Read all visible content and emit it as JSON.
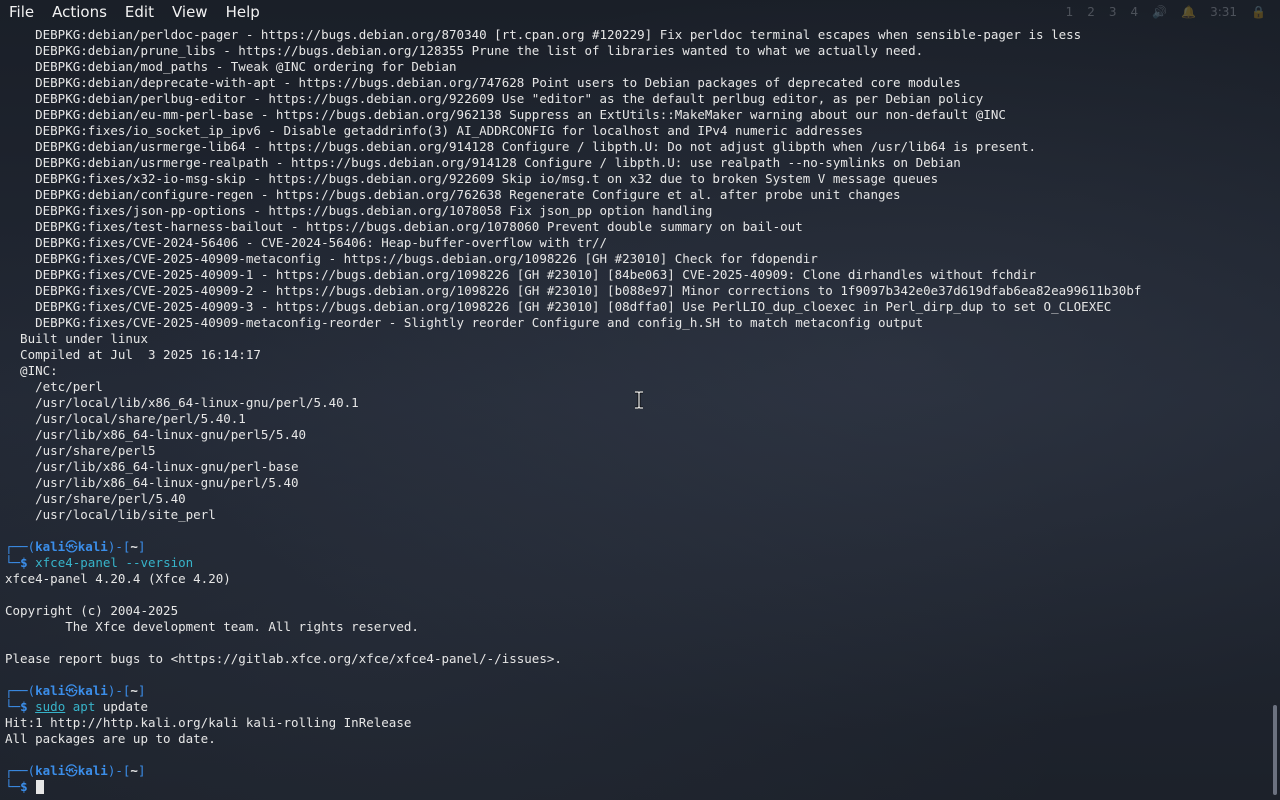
{
  "menubar": {
    "items": [
      "File",
      "Actions",
      "Edit",
      "View",
      "Help"
    ]
  },
  "tray": {
    "workspaces": [
      "1",
      "2",
      "3",
      "4"
    ],
    "clock": "3:31"
  },
  "terminal": {
    "output_top": [
      "    DEBPKG:debian/perldoc-pager - https://bugs.debian.org/870340 [rt.cpan.org #120229] Fix perldoc terminal escapes when sensible-pager is less",
      "    DEBPKG:debian/prune_libs - https://bugs.debian.org/128355 Prune the list of libraries wanted to what we actually need.",
      "    DEBPKG:debian/mod_paths - Tweak @INC ordering for Debian",
      "    DEBPKG:debian/deprecate-with-apt - https://bugs.debian.org/747628 Point users to Debian packages of deprecated core modules",
      "    DEBPKG:debian/perlbug-editor - https://bugs.debian.org/922609 Use \"editor\" as the default perlbug editor, as per Debian policy",
      "    DEBPKG:debian/eu-mm-perl-base - https://bugs.debian.org/962138 Suppress an ExtUtils::MakeMaker warning about our non-default @INC",
      "    DEBPKG:fixes/io_socket_ip_ipv6 - Disable getaddrinfo(3) AI_ADDRCONFIG for localhost and IPv4 numeric addresses",
      "    DEBPKG:debian/usrmerge-lib64 - https://bugs.debian.org/914128 Configure / libpth.U: Do not adjust glibpth when /usr/lib64 is present.",
      "    DEBPKG:debian/usrmerge-realpath - https://bugs.debian.org/914128 Configure / libpth.U: use realpath --no-symlinks on Debian",
      "    DEBPKG:fixes/x32-io-msg-skip - https://bugs.debian.org/922609 Skip io/msg.t on x32 due to broken System V message queues",
      "    DEBPKG:debian/configure-regen - https://bugs.debian.org/762638 Regenerate Configure et al. after probe unit changes",
      "    DEBPKG:fixes/json-pp-options - https://bugs.debian.org/1078058 Fix json_pp option handling",
      "    DEBPKG:fixes/test-harness-bailout - https://bugs.debian.org/1078060 Prevent double summary on bail-out",
      "    DEBPKG:fixes/CVE-2024-56406 - CVE-2024-56406: Heap-buffer-overflow with tr//",
      "    DEBPKG:fixes/CVE-2025-40909-metaconfig - https://bugs.debian.org/1098226 [GH #23010] Check for fdopendir",
      "    DEBPKG:fixes/CVE-2025-40909-1 - https://bugs.debian.org/1098226 [GH #23010] [84be063] CVE-2025-40909: Clone dirhandles without fchdir",
      "    DEBPKG:fixes/CVE-2025-40909-2 - https://bugs.debian.org/1098226 [GH #23010] [b088e97] Minor corrections to 1f9097b342e0e37d619dfab6ea82ea99611b30bf",
      "    DEBPKG:fixes/CVE-2025-40909-3 - https://bugs.debian.org/1098226 [GH #23010] [08dffa0] Use PerlLIO_dup_cloexec in Perl_dirp_dup to set O_CLOEXEC",
      "    DEBPKG:fixes/CVE-2025-40909-metaconfig-reorder - Slightly reorder Configure and config_h.SH to match metaconfig output",
      "  Built under linux",
      "  Compiled at Jul  3 2025 16:14:17",
      "  @INC:",
      "    /etc/perl",
      "    /usr/local/lib/x86_64-linux-gnu/perl/5.40.1",
      "    /usr/local/share/perl/5.40.1",
      "    /usr/lib/x86_64-linux-gnu/perl5/5.40",
      "    /usr/share/perl5",
      "    /usr/lib/x86_64-linux-gnu/perl-base",
      "    /usr/lib/x86_64-linux-gnu/perl/5.40",
      "    /usr/share/perl/5.40",
      "    /usr/local/lib/site_perl",
      ""
    ],
    "prompt": {
      "top_left": "┌──(",
      "user": "kali",
      "at": "㉿",
      "host": "kali",
      "mid": ")-[",
      "dir": "~",
      "end": "]",
      "bottom_left": "└─",
      "dollar": "$"
    },
    "cmd1": {
      "command": "xfce4-panel",
      "args": "--version"
    },
    "output_cmd1": [
      "xfce4-panel 4.20.4 (Xfce 4.20)",
      "",
      "Copyright (c) 2004-2025",
      "        The Xfce development team. All rights reserved.",
      "",
      "Please report bugs to <https://gitlab.xfce.org/xfce/xfce4-panel/-/issues>.",
      ""
    ],
    "cmd2": {
      "sudo": "sudo",
      "command": "apt",
      "args": "update"
    },
    "output_cmd2": [
      "Hit:1 http://http.kali.org/kali kali-rolling InRelease",
      "All packages are up to date.",
      ""
    ]
  },
  "colors": {
    "prompt_blue": "#3b8eea",
    "command_cyan": "#37b3c9",
    "text": "#e6e6e6",
    "background": "#1d222c"
  }
}
